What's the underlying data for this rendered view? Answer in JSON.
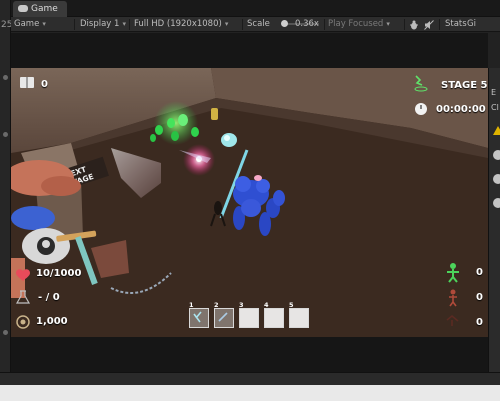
{
  "left_panel": {
    "number": "25"
  },
  "tab": {
    "label": "Game",
    "icon": "gamepad-icon"
  },
  "toolbar": {
    "mode": "Game",
    "display": "Display 1",
    "resolution": "Full HD (1920x1080)",
    "scale_label": "Scale",
    "scale_value": "0.36x",
    "play_mode": "Play Focused",
    "stats": "Stats",
    "gizmos": "Gi",
    "icons": [
      "dropdown-caret-icon",
      "bug-icon",
      "audio-mute-icon",
      "speaker-icon"
    ]
  },
  "hud": {
    "book_count": "0",
    "stage": "STAGE 5",
    "timer": "00:00:00",
    "health": "10/1000",
    "potion": "- / 0",
    "gold": "1,000",
    "ally_counts": [
      "0",
      "0",
      "0"
    ],
    "ability_slots": [
      "1",
      "2",
      "3",
      "4",
      "5"
    ]
  },
  "scene": {
    "sign_text": "NEXT STAGE"
  },
  "right_panel": {
    "labels": [
      "E",
      "Cl"
    ]
  },
  "colors": {
    "ground": "#3a2b22",
    "wall": "#6e5a4e",
    "character": "#3a5ad8",
    "hud_text": "#ffffff"
  }
}
